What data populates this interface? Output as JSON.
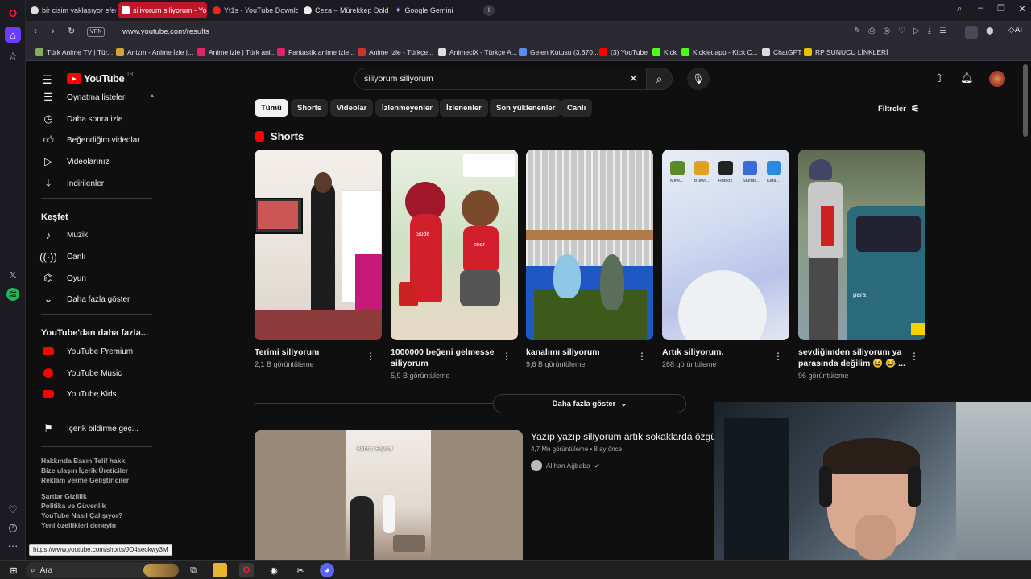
{
  "browser": {
    "tabs": [
      {
        "label": "bir cisim yaklaşıyor efendi",
        "active": false
      },
      {
        "label": "siliyorum siliyorum - You",
        "active": true
      },
      {
        "label": "Yt1s - YouTube Download",
        "active": false
      },
      {
        "label": "Ceza – Mürekkep Doldurd",
        "active": false
      },
      {
        "label": "Google Gemini",
        "active": false
      }
    ],
    "url": "www.youtube.com/results",
    "vpn": "VPN",
    "ai_label": "AI",
    "bookmarks": [
      "Türk Anime TV | Tür...",
      "Anizm - Anime İzle |...",
      "Anime izle | Türk ani...",
      "Fantastik anime izle...",
      "Anime İzle - Türkçe...",
      "AnimeciX - Türkçe A...",
      "Gelen Kutusu (3.670...",
      "(3) YouTube",
      "Kick",
      "Kicklet.app - Kick C...",
      "ChatGPT",
      "RP SUNUCU LİNKLERİ"
    ],
    "status_url": "https://www.youtube.com/shorts/JO4seokwy3M"
  },
  "youtube": {
    "logo": "YouTube",
    "logo_region": "TR",
    "search_query": "siliyorum siliyorum",
    "guide": {
      "top_items": [
        {
          "label": "Oynatma listeleri",
          "icon": "playlist-icon"
        },
        {
          "label": "Daha sonra izle",
          "icon": "clock-icon"
        },
        {
          "label": "Beğendiğim videolar",
          "icon": "thumbs-up-icon"
        },
        {
          "label": "Videolarınız",
          "icon": "play-icon"
        },
        {
          "label": "İndirilenler",
          "icon": "download-icon"
        }
      ],
      "explore_title": "Keşfet",
      "explore_items": [
        {
          "label": "Müzik",
          "icon": "music-icon"
        },
        {
          "label": "Canlı",
          "icon": "live-icon"
        },
        {
          "label": "Oyun",
          "icon": "gamepad-icon"
        },
        {
          "label": "Daha fazla göster",
          "icon": "chevron-down-icon"
        }
      ],
      "more_title": "YouTube'dan daha fazla...",
      "more_items": [
        {
          "label": "YouTube Premium"
        },
        {
          "label": "YouTube Music"
        },
        {
          "label": "YouTube Kids"
        }
      ],
      "report_label": "İçerik bildirme geç...",
      "footer_lines": [
        "Hakkında  Basın  Telif hakkı",
        "Bize ulaşın  İçerik Üreticiler",
        "Reklam verme  Geliştiriciler",
        "Şartlar  Gizlilik",
        "Politika ve Güvenlik",
        "YouTube Nasıl Çalışıyor?",
        "Yeni özellikleri deneyin"
      ]
    },
    "chips": [
      "Tümü",
      "Shorts",
      "Videolar",
      "İzlenmeyenler",
      "İzlenenler",
      "Son yüklenenler",
      "Canlı"
    ],
    "filters_label": "Filtreler",
    "shorts_title": "Shorts",
    "shorts": [
      {
        "title": "Terimi siliyorum",
        "views": "2,1 B görüntüleme"
      },
      {
        "title": "1000000 beğeni gelmesse siliyorum",
        "views": "5,9 B görüntüleme"
      },
      {
        "title": "kanalımı siliyorum",
        "views": "9,6 B görüntüleme"
      },
      {
        "title": "Artık siliyorum.",
        "views": "268 görüntüleme"
      },
      {
        "title": "sevdiğimden siliyorum ya parasında değilim 😆 😂 ...",
        "views": "96 görüntüleme"
      }
    ],
    "thumb_text": {
      "s2_name1": "Sude",
      "s2_name2": "onar",
      "s4_apps": [
        "Mine...",
        "Brawl ...",
        "Roblox",
        "Stumb...",
        "Kafa ..."
      ],
      "s5_text": "para",
      "video_overlay": "Bahsin Baysal"
    },
    "show_more_label": "Daha fazla göster",
    "video": {
      "title": "Yazıp yazıp siliyorum artık sokaklarda özgü",
      "meta": "4,7 Mn görüntüleme • 8 ay önce",
      "channel": "Alihan Ağbaba"
    }
  },
  "taskbar": {
    "search_label": "Ara"
  }
}
